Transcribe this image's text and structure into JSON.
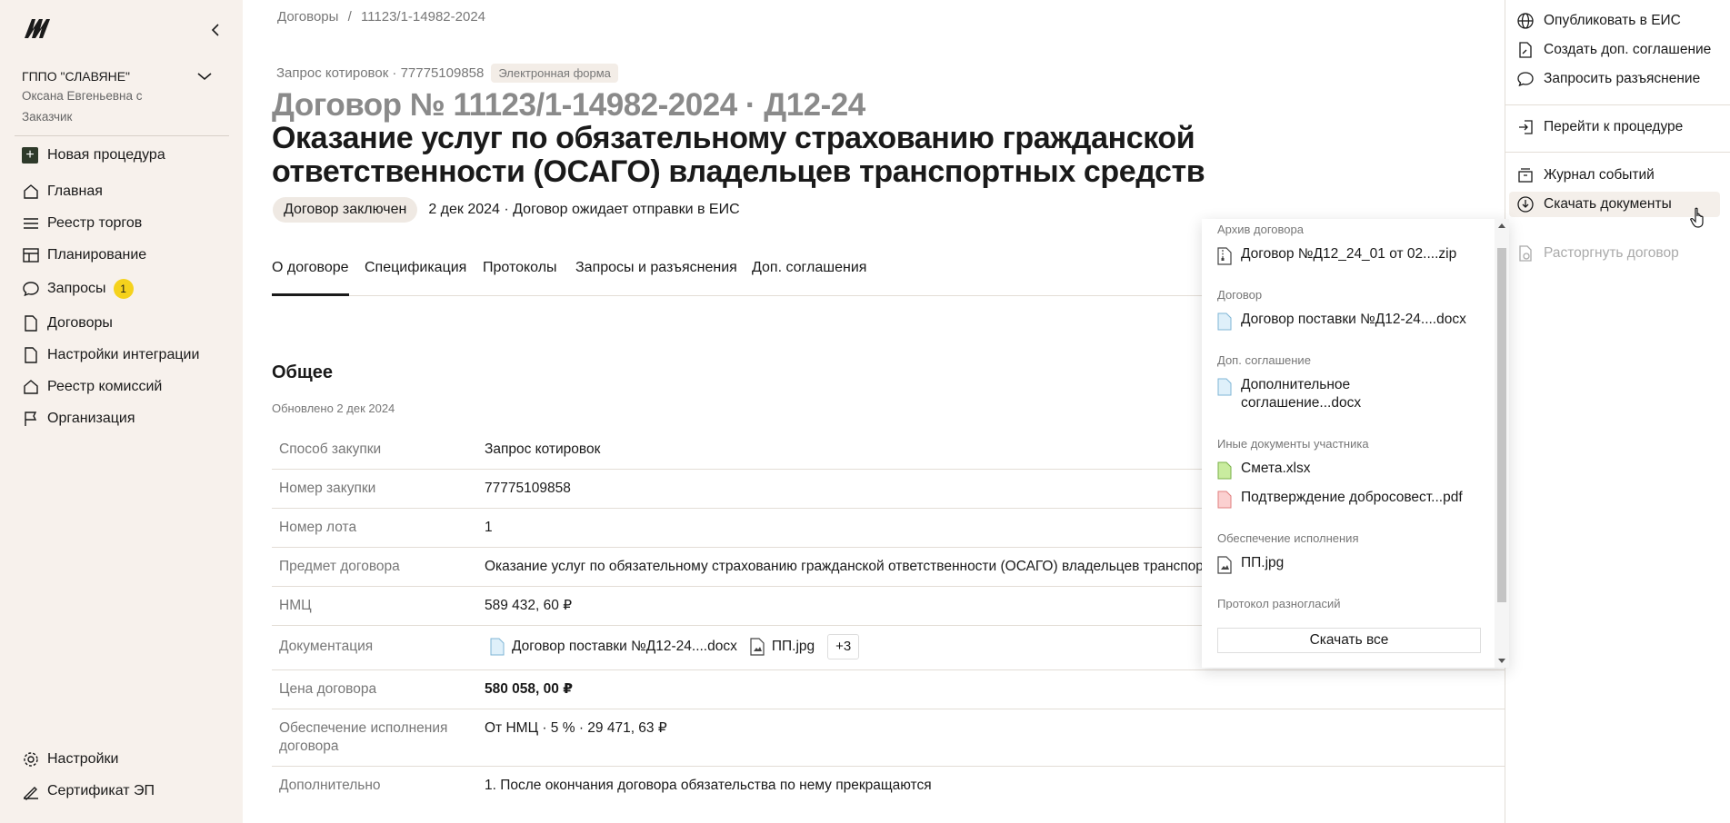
{
  "sidebar": {
    "org_name": "ГППО \"СЛАВЯНЕ\"",
    "org_user": "Оксана Евгеньевна с Заказчик",
    "new_procedure": "Новая процедура",
    "items": [
      {
        "label": "Главная",
        "icon": "home-icon"
      },
      {
        "label": "Реестр торгов",
        "icon": "list-icon"
      },
      {
        "label": "Планирование",
        "icon": "layout-icon"
      },
      {
        "label": "Запросы",
        "icon": "chat-icon",
        "badge": "1"
      },
      {
        "label": "Договоры",
        "icon": "document-icon"
      },
      {
        "label": "Настройки интеграции",
        "icon": "document-icon"
      },
      {
        "label": "Реестр комиссий",
        "icon": "home-icon"
      },
      {
        "label": "Организация",
        "icon": "flag-icon"
      }
    ],
    "bottom": [
      {
        "label": "Настройки",
        "icon": "gear-icon"
      },
      {
        "label": "Сертификат ЭП",
        "icon": "signature-icon"
      }
    ]
  },
  "breadcrumbs": {
    "root": "Договоры",
    "sep": "/",
    "current": "11123/1-14982-2024"
  },
  "header": {
    "meta": "Запрос котировок · 77775109858",
    "tag": "Электронная форма",
    "number": "Договор № 11123/1-14982-2024 · Д12-24",
    "title": "Оказание услуг по обязательному страхованию гражданской ответственности (ОСАГО) владельцев транспортных средств",
    "status": "Договор заключен",
    "status_note": "2 дек 2024 · Договор ожидает отправки в ЕИС"
  },
  "tabs": [
    "О договоре",
    "Спецификация",
    "Протоколы",
    "Запросы и разъяснения",
    "Доп. соглашения"
  ],
  "general": {
    "title": "Общее",
    "updated": "Обновлено 2 дек 2024",
    "rows": [
      {
        "k": "Способ закупки",
        "v": "Запрос котировок"
      },
      {
        "k": "Номер закупки",
        "v": "77775109858"
      },
      {
        "k": "Номер лота",
        "v": "1"
      },
      {
        "k": "Предмет договора",
        "v": "Оказание услуг по обязательному страхованию гражданской ответственности (ОСАГО) владельцев транспортных средств"
      },
      {
        "k": "НМЦ",
        "v": "589 432, 60 ₽"
      }
    ],
    "docs_label": "Документация",
    "docs": [
      "Договор поставки №Д12-24....docx",
      "ПП.jpg"
    ],
    "docs_more": "+3",
    "price_label": "Цена договора",
    "price": "580 058, 00 ₽",
    "security_label": "Обеспечение исполнения договора",
    "security": "От НМЦ · 5 % · 29 471, 63 ₽",
    "extra_label": "Дополнительно",
    "extra": "1. После окончания договора обязательства по нему прекращаются"
  },
  "actions": {
    "publish": "Опубликовать в ЕИС",
    "create_agreement": "Создать доп. соглашение",
    "request_clarification": "Запросить разъяснение",
    "go_procedure": "Перейти к процедуре",
    "event_log": "Журнал событий",
    "download_docs": "Скачать документы",
    "terminate": "Расторгнуть договор"
  },
  "download_menu": {
    "groups": [
      {
        "title": "Архив договора",
        "files": [
          {
            "name": "Договор №Д12_24_01 от 02....zip",
            "type": "zip"
          }
        ]
      },
      {
        "title": "Договор",
        "files": [
          {
            "name": "Договор поставки №Д12-24....docx",
            "type": "docx"
          }
        ]
      },
      {
        "title": "Доп. соглашение",
        "files": [
          {
            "name": "Дополнительное соглашение...docx",
            "type": "docx"
          }
        ]
      },
      {
        "title": "Иные документы участника",
        "files": [
          {
            "name": "Смета.xlsx",
            "type": "xlsx"
          },
          {
            "name": "Подтверждение добросовест...pdf",
            "type": "pdf"
          }
        ]
      },
      {
        "title": "Обеспечение исполнения",
        "files": [
          {
            "name": "ПП.jpg",
            "type": "jpg"
          }
        ]
      },
      {
        "title": "Протокол разногласий",
        "files": []
      }
    ],
    "download_all": "Скачать все"
  },
  "colors": {
    "sidebar_bg": "#f7f1ec",
    "badge": "#f5d21c",
    "docx": "#bfe3f5",
    "xlsx": "#b9e28c",
    "pdf": "#f6b9b9"
  }
}
